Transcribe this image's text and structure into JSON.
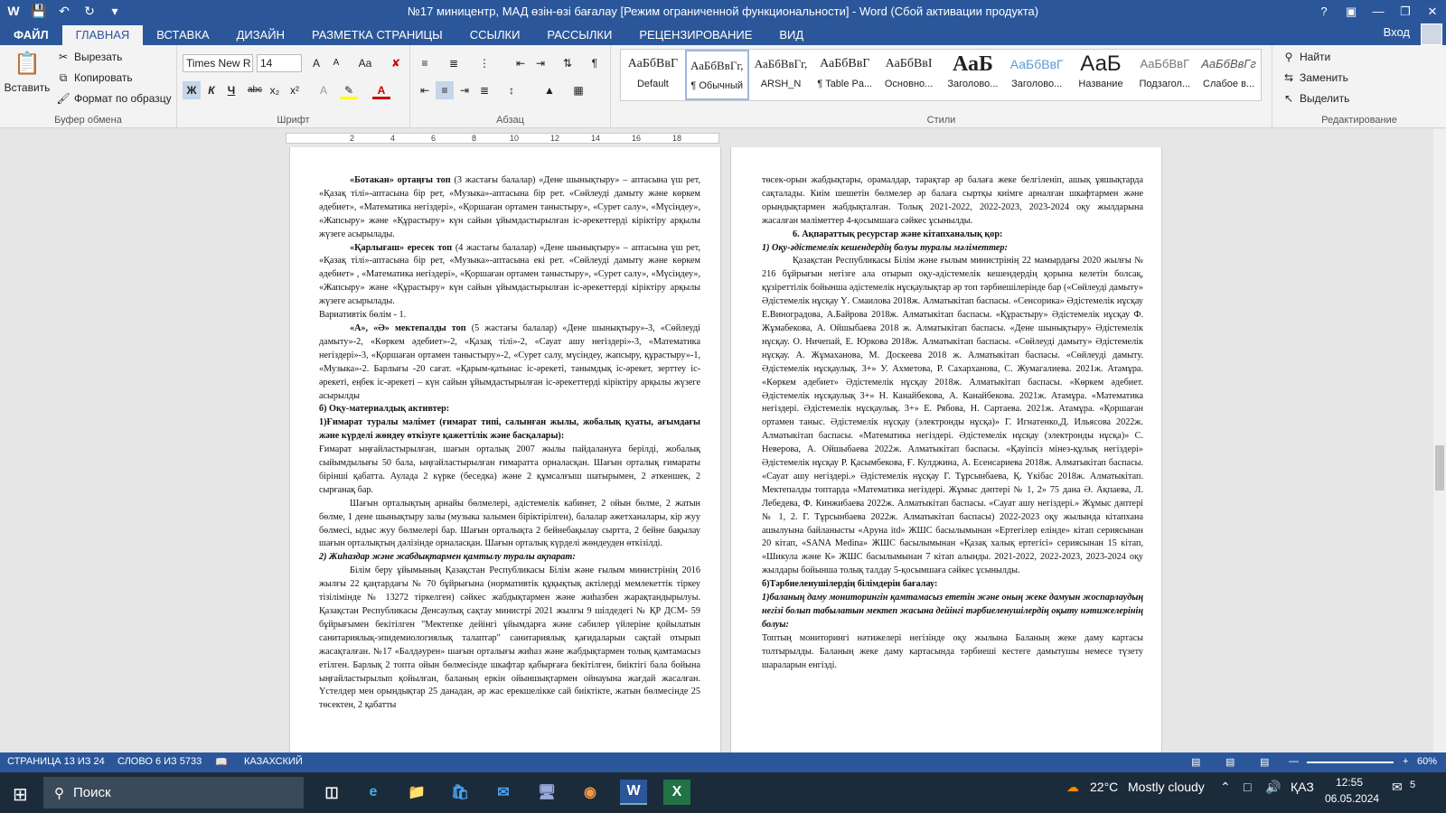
{
  "titlebar": {
    "title": "№17 миницентр, МАД өзін-өзі бағалау [Режим ограниченной функциональности] - Word (Сбой активации продукта)",
    "help": "?"
  },
  "tabs": {
    "file": "ФАЙЛ",
    "items": [
      "ГЛАВНАЯ",
      "ВСТАВКА",
      "ДИЗАЙН",
      "РАЗМЕТКА СТРАНИЦЫ",
      "ССЫЛКИ",
      "РАССЫЛКИ",
      "РЕЦЕНЗИРОВАНИЕ",
      "ВИД"
    ],
    "login": "Вход"
  },
  "clipboard": {
    "paste": "Вставить",
    "cut": "Вырезать",
    "copy": "Копировать",
    "format": "Формат по образцу",
    "label": "Буфер обмена"
  },
  "font": {
    "name": "Times New R",
    "size": "14",
    "label": "Шрифт",
    "bold": "Ж",
    "italic": "К",
    "underline": "Ч",
    "strike": "abc",
    "sub": "x₂",
    "sup": "x²",
    "grow": "A",
    "shrink": "A",
    "case": "Aa"
  },
  "paragraph": {
    "label": "Абзац"
  },
  "styles": {
    "label": "Стили",
    "items": [
      {
        "preview": "АаБбВвГ",
        "name": "Default"
      },
      {
        "preview": "АаБбВвГг,",
        "name": "¶ Обычный"
      },
      {
        "preview": "АаБбВвГг,",
        "name": "ARSH_N"
      },
      {
        "preview": "АаБбВвГ",
        "name": "¶ Table Pa..."
      },
      {
        "preview": "АаБбВвI",
        "name": "Основно..."
      },
      {
        "preview": "АаБ",
        "name": "Заголово..."
      },
      {
        "preview": "АаБбВвГ",
        "name": "Заголово..."
      },
      {
        "preview": "АаБ",
        "name": "Название"
      },
      {
        "preview": "АаБбВвГ",
        "name": "Подзагол..."
      },
      {
        "preview": "АаБбВвГг",
        "name": "Слабое в..."
      }
    ]
  },
  "editing": {
    "label": "Редактирование",
    "find": "Найти",
    "replace": "Заменить",
    "select": "Выделить"
  },
  "ruler": {
    "ticks": [
      "2",
      "4",
      "6",
      "8",
      "10",
      "12",
      "14",
      "16",
      "18"
    ]
  },
  "page_left": [
    {
      "cls": "ind",
      "lead": "«Ботакан» ортаңғы топ",
      "text": " (3 жастағы балалар) «Дене шынықтыру» – аптасына үш рет, «Қазақ тілі»-аптасына бір рет, «Музыка»-аптасына бір рет. «Сөйлеуді дамыту және көркем әдебиет», «Математика негіздері», «Қоршаған ортамен таныстыру», «Сурет салу», «Мүсіндеу», «Жапсыру» және «Құрастыру» күн сайын ұйымдастырылған іс-әрекеттерді кіріктіру арқылы жүзеге асырылады."
    },
    {
      "cls": "ind",
      "lead": "«Қарлығаш» ересек топ",
      "text": " (4 жастағы балалар) «Дене шынықтыру» – аптасына үш рет, «Қазақ тілі»-аптасына бір рет, «Музыка»-аптасына екі рет. «Сөйлеуді дамыту және көркем әдебиет» , «Математика негіздері», «Қоршаған ортамен таныстыру», «Сурет салу», «Мүсіндеу», «Жапсыру» және «Құрастыру» күн сайын ұйымдастырылған іс-әрекеттерді кіріктіру арқылы жүзеге асырылады."
    },
    {
      "cls": "",
      "lead": "",
      "text": "Вариативтік бөлім - 1."
    },
    {
      "cls": "ind",
      "lead": "«А», «Ә» мектепалды топ",
      "text": " (5 жастағы балалар) «Дене шынықтыру»-3, «Сөйлеуді дамыту»-2, «Көркем әдебиет»-2, «Қазақ тілі»-2, «Сауат ашу негіздері»-3, «Математика негіздері»-3, «Қоршаған ортамен таныстыру»-2, «Сурет салу, мүсіндеу, жапсыру, құрастыру»-1, «Музыка»-2. Барлығы -20 сағат. «Қарым-қатынас іс-әрекеті, танымдық іс-әрекет, зерттеу іс-әрекеті, еңбек іс-әрекеті – күн сайын ұйымдастырылған іс-әрекеттерді кіріктіру арқылы жүзеге асырылды"
    },
    {
      "cls": "b",
      "lead": "",
      "text": "б) Оқу-материалдық активтер:"
    },
    {
      "cls": "b",
      "lead": "",
      "text": "1)Ғимарат туралы мәлімет (ғимарат типі, салынған жылы, жобалық қуаты, ағымдағы және күрделі жөндеу өткізуге қажеттілік және басқалары):"
    },
    {
      "cls": "",
      "lead": "",
      "text": "Ғимарат ыңғайластырылған, шағын орталық 2007 жылы пайдалануға берілді, жобалық сыйымдылығы 50 бала, ыңғайластырылған ғимаратта орналасқан. Шағын орталық ғимараты бірінші қабатта. Аулада 2 күрке (беседка) және 2 құмсалғыш шатырымен, 2 әткеншек, 2 сырғанақ бар."
    },
    {
      "cls": "ind",
      "lead": "",
      "text": "Шағын орталықтың арнайы бөлмелері, әдістемелік кабинет, 2 ойын бөлме, 2 жатын бөлме, 1 дене шынықтыру залы (музыка залымен біріктірілген), балалар әжетханалары, кір жуу бөлмесі, ыдыс жуу бөлмелері бар. Шағын орталықта 2 бейнебақылау сыртта, 2 бейне бақылау шағын орталықтың дәлізінде орналасқан. Шағын орталық күрделі жөндеуден өткізілді."
    },
    {
      "cls": "bi",
      "lead": "",
      "text": "2) Жиһаздар және жабдықтармен қамтылу туралы ақпарат:"
    },
    {
      "cls": "ind",
      "lead": "",
      "text": "Білім беру ұйымының Қазақстан Республикасы Білім және ғылым министрінің 2016 жылғы 22 қаңтардағы № 70 бұйрығына (нормативтік құқықтық актілерді мемлекеттік тіркеу тізілімінде № 13272 тіркелген) сәйкес жабдықтармен және жиһазбен жарақтандырылуы. Қазақстан Республикасы Денсаулық сақтау министрі 2021 жылғы 9 шілдедегі № ҚР ДСМ- 59 бұйрығымен бекітілген \"Мектепке дейінгі ұйымдарға және сәбилер үйлеріне қойылатын санитариялық-эпидемиологиялық талаптар\" санитариялық қағидаларын сақтай отырып жасақталған. №17 «Балдәурен» шағын орталығы жиһаз және жабдықтармен толық қамтамасыз етілген. Барлық 2 топта ойын бөлмесіндe шкафтар қабырғаға бекітілген, биіктігі бала бойына ыңғайластырылып қойылған, баланың еркін ойыншықтармен ойнауына жағдай жасалған. Үстелдер мен орындықтар 25 данадан, әр жас ерекшелікке сай биіктікте, жатын бөлмесінде 25 төсектен, 2 қабатты"
    }
  ],
  "page_right": [
    {
      "cls": "",
      "lead": "",
      "text": "төсек-орын жабдықтары, орамалдар, тарақтар әр балаға жеке белгіленіп, ашық ұяшықтарда сақталады. Киім шешетін бөлмелер әр балаға сыртқы киімге арналған шкафтармен және орындықтармен жабдықталған. Толық 2021-2022, 2022-2023, 2023-2024 оқу жылдарына жасалған мәліметтер 4-қосымшаға сәйкес ұсынылды."
    },
    {
      "cls": "ind b",
      "lead": "",
      "text": "6. Ақпараттық ресурстар және кітапханалық қор:"
    },
    {
      "cls": "bi",
      "lead": "",
      "text": "1) Оқу-әдістемелік кешендердің болуы туралы мәліметтер:"
    },
    {
      "cls": "ind",
      "lead": "",
      "text": "Қазақстан Республикасы Білім және ғылым министрінің 22 мамырдағы 2020 жылғы № 216 бұйрығын негізге ала отырып оқу-әдістемелік кешендердің қорына келетін болсақ, құзіреттілік бойынша әдістемелік нұсқаулықтар әр топ тәрбиешілерінде бар («Сөйлеуді дамыту» Әдістемелік нұсқау Ү. Смаилова 2018ж. Алматыкітап баспасы. «Сенсорика» Әдістемелік нұсқау Е.Виноградова, А.Байрова 2018ж. Алматыкітап баспасы. «Құрастыру» Әдістемелік нұсқау Ф. Жұмабекова, А. Ойшыбаева 2018 ж. Алматыкітап баспасы. «Дене шынықтыру» Әдістемелік нұсқау. О. Ничепай, Е. Юркова 2018ж. Алматыкітап баспасы. «Сөйлеуді дамыту» Әдістемелік нұсқау. А. Жұмаханова, М. Доскеева 2018 ж. Алматыкітап баспасы. «Сөйлеуді дамыту. Әдістемелік нұсқаулық. 3+» У. Ахметова, Р. Сахарханова, С. Жумагалиева. 2021ж. Атамұра. «Көркем әдебиет» Әдістемелік нұсқау 2018ж. Алматыкітап баспасы. «Көркем әдебиет. Әдістемелік нұсқаулық 3+» Н. Канайбекова, А. Канайбекова. 2021ж. Атамұра. «Математика негіздері. Әдістемелік нұсқаулық. 3+» Е. Рябова, Н. Сартаева. 2021ж. Атамұра. «Қоршаған ортамен таныс. Әдістемелік нұсқау (электронды нұсқа)» Г. Игнатенко,Д. Ильясова 2022ж. Алматыкітап баспасы. «Математика негіздері. Әдістемелік нұсқау (электронды нұсқа)» С. Неверова, А. Ойшыбаева 2022ж. Алматыкітап баспасы. «Қауіпсіз мінез-құлық негіздері» Әдістемелік нұсқау Р. Қасымбекова, Ғ. Кулджина, А. Есенсариева 2018ж. Алматыкітап баспасы. «Сауат ашу негіздері.» Әдістемелік нұсқау Г. Тұрсынбаева, Қ. Үкібас 2018ж. Алматыкітап. Мектепалды топтарда «Математика негіздері. Жұмыс дәптері № 1, 2» 75 дана Ә. Ақпаева, Л. Лебедева, Ф. Кинжибаева 2022ж. Алматыкітап баспасы. «Сауат ашу негіздері.» Жұмыс дәптері № 1, 2. Г. Тұрсынбаева 2022ж. Алматыкітап баспасы) 2022-2023 оқу жылында кітапхана ашылуына байланысты «Аруна itd» ЖШС басылымынан «Ертегілер елінде» кітап сериясынан 20 кітап, «SANA Medina» ЖШС басылымынан «Қазақ халық ертегісі» сериясынан 15 кітап, «Шикула және К» ЖШС басылымынан 7 кітап алынды. 2021-2022, 2022-2023, 2023-2024 оқу жылдары бойынша толық талдау 5-қосымшаға сәйкес ұсынылды."
    },
    {
      "cls": "b",
      "lead": "",
      "text": "б)Тәрбиеленушілердің білімдерін бағалау:"
    },
    {
      "cls": "bi",
      "lead": "",
      "text": "1)баланың даму мониторингін қамтамасыз ететін және оның жеке дамуын жоспарлаудың негізі болып табылатын мектеп жасына дейінгі тәрбиеленушілердің оқыту нәтижелерінің болуы:"
    },
    {
      "cls": "",
      "lead": "",
      "text": "Топтың мониторингі нәтижелері негізінде оқу жылына Баланың жеке даму картасы толтырылды. Баланың жеке даму картасында тәрбиеші кестеге дамытушы немесе түзету шараларын енгізді."
    }
  ],
  "status": {
    "page": "СТРАНИЦА 13 ИЗ 24",
    "words": "СЛОВО 6 ИЗ 5733",
    "lang": "КАЗАХСКИЙ",
    "zoom": "60%"
  },
  "taskbar": {
    "search": "Поиск",
    "weather_temp": "22°C",
    "weather": "Mostly cloudy",
    "lang": "ҚАЗ",
    "time": "12:55",
    "date": "06.05.2024",
    "notif": "5"
  }
}
